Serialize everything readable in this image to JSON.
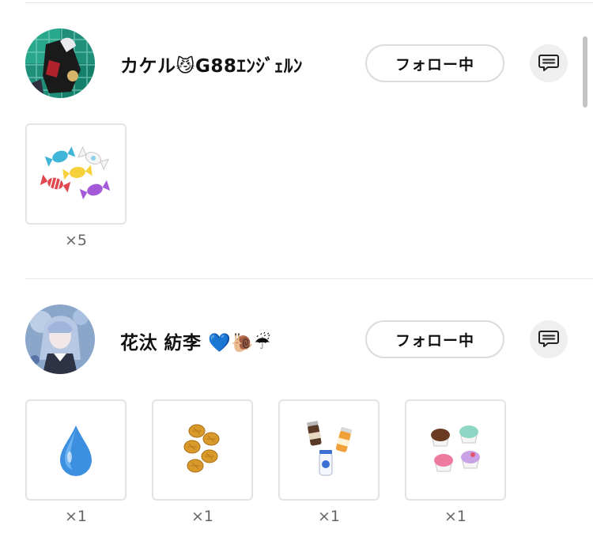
{
  "users": [
    {
      "name": "カケル😼G88ｴﾝｼﾞｪﾙﾝ",
      "follow_label": "フォロー中",
      "gifts": [
        {
          "icon": "candies-icon",
          "count": "×5"
        }
      ]
    },
    {
      "name": "花汰 紡李 💙🐌☔",
      "follow_label": "フォロー中",
      "gifts": [
        {
          "icon": "water-drop-icon",
          "count": "×1"
        },
        {
          "icon": "madeleines-icon",
          "count": "×1"
        },
        {
          "icon": "drink-bottles-icon",
          "count": "×1"
        },
        {
          "icon": "cupcakes-icon",
          "count": "×1"
        }
      ]
    }
  ],
  "colors": {
    "button_border": "#dcdcdc",
    "message_button_bg": "#efefef",
    "divider": "#e6e6e6",
    "count_text": "#666666"
  }
}
